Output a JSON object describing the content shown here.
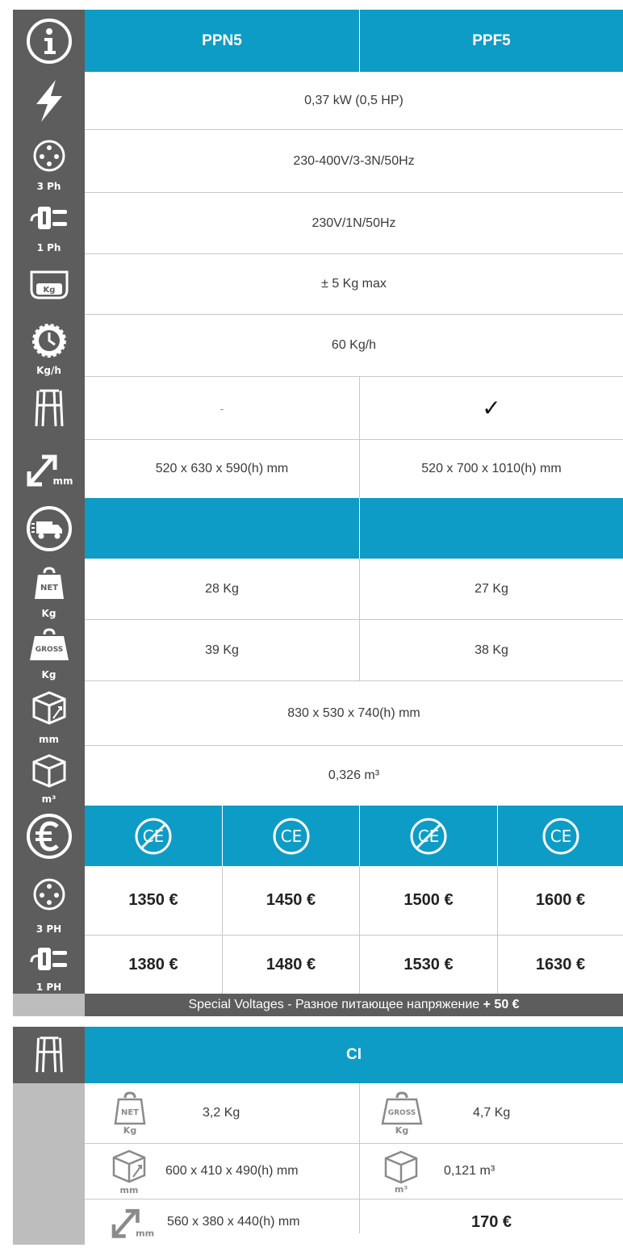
{
  "header": {
    "col1": "PPN5",
    "col2": "PPF5"
  },
  "icon_labels": {
    "three_phase": "3 Ph",
    "single_phase": "1 Ph",
    "kg": "Kg",
    "kgh": "Kg/h",
    "mm": "mm",
    "net": "NET",
    "gross": "GROSS",
    "m3": "m³",
    "three_phase_caps": "3 PH",
    "single_phase_caps": "1 PH"
  },
  "specs": {
    "power": "0,37 kW (0,5 HP)",
    "three_phase": "230-400V/3-3N/50Hz",
    "single_phase": "230V/1N/50Hz",
    "capacity": "± 5 Kg max",
    "production": "60 Kg/h",
    "stand_ppn5": "-",
    "stand_ppf5": "✓",
    "dim_ppn5": "520 x 630 x 590(h) mm",
    "dim_ppf5": "520 x 700 x 1010(h) mm"
  },
  "shipping": {
    "net_ppn5": "28 Kg",
    "net_ppf5": "27 Kg",
    "gross_ppn5": "39 Kg",
    "gross_ppf5": "38 Kg",
    "package_dim": "830 x 530 x 740(h) mm",
    "volume": "0,326 m³"
  },
  "prices": {
    "three_phase": [
      "1350 €",
      "1450 €",
      "1500 €",
      "1600 €"
    ],
    "single_phase": [
      "1380 €",
      "1480 €",
      "1530 €",
      "1630 €"
    ],
    "special_text": "Special Voltages - Разное питающее напряжение",
    "special_price": "+ 50 €"
  },
  "accessory": {
    "title": "CI",
    "net": "3,2 Kg",
    "gross": "4,7 Kg",
    "package_dim": "600 x 410 x 490(h) mm",
    "volume": "0,121 m³",
    "dim": "560 x 380 x 440(h) mm",
    "price": "170 €"
  },
  "colors": {
    "blue": "#0d9cc6",
    "icon_bg": "#5d5d5d",
    "gray": "#bdbdbd"
  }
}
